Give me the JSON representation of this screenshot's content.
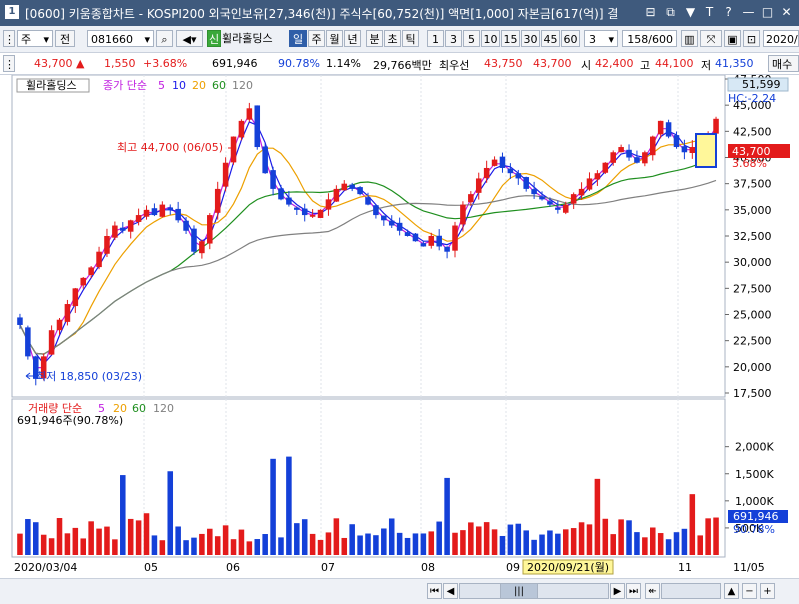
{
  "window": {
    "app_number": "1",
    "title": "[0600] 키움종합차트 - KOSPI200 외국인보유[27,346(천)] 주식수[60,752(천)] 액면[1,000] 자본금[617(억)] 결",
    "buttons": [
      "⊟",
      "⧉",
      "▼",
      "T",
      "?",
      "—",
      "□",
      "✕"
    ]
  },
  "toolbar": {
    "period_unit": "주",
    "before_label": "전",
    "stock_code": "081660",
    "badge": "신",
    "stock_name": "휠라홀딩스",
    "period_tabs": [
      "일",
      "주",
      "월",
      "년",
      "분",
      "초",
      "틱"
    ],
    "active_period": "일",
    "intervals": [
      "1",
      "3",
      "5",
      "10",
      "15",
      "30",
      "45",
      "60"
    ],
    "interval_value": "3",
    "count": "158/600",
    "date": "2020/"
  },
  "quote": {
    "price": "43,700",
    "change": "1,550",
    "change_pct": "+3.68%",
    "volume": "691,946",
    "volume_pct": "90.78%",
    "turnover_pct": "1.14%",
    "amount": "29,766백만",
    "best_ask_label": "최우선",
    "best_ask": "43,750",
    "best_bid": "43,700",
    "open_label": "시",
    "open": "42,400",
    "high_label": "고",
    "high": "44,100",
    "low_label": "저",
    "low": "41,350",
    "trade_btn": "매수"
  },
  "price_panel": {
    "legend_name": "휠라홀딩스",
    "legend_text": "종가 단순",
    "ma_periods": [
      "5",
      "10",
      "20",
      "60",
      "120"
    ],
    "ma_colors": [
      "#c11de0",
      "#1a1ae8",
      "#eda000",
      "#1f8f1f",
      "#808080"
    ],
    "up_color": "#e31b1b",
    "down_color": "#1440d8",
    "annot_high": "최고 44,700 (06/05)",
    "annot_low": "최저 18,850 (03/23)",
    "current_tag": "51,599",
    "hc_text": "HC:-2.24",
    "price_tag": "43,700",
    "pct_tag": "3.68%",
    "axis_labels": [
      "47,500",
      "45,000",
      "42,500",
      "40,000",
      "37,500",
      "35,000",
      "32,500",
      "30,000",
      "27,500",
      "25,000",
      "22,500",
      "20,000",
      "17,500"
    ]
  },
  "volume_panel": {
    "legend_text": "거래량 단순",
    "ma_periods": [
      "5",
      "20",
      "60",
      "120"
    ],
    "info": "691,946주(90.78%)",
    "axis_labels": [
      "2,000K",
      "1,500K",
      "1,000K",
      "500K"
    ],
    "tag_value": "691,946",
    "tag_pct": "90.78%"
  },
  "date_axis": {
    "labels": [
      "2020/03/04",
      "05",
      "06",
      "07",
      "08",
      "09",
      "11",
      "11/05"
    ],
    "cursor_date": "2020/09/21(월)"
  },
  "chart_data": {
    "type": "candlestick",
    "symbol": "081660",
    "name": "휠라홀딩스",
    "period": "daily",
    "x_range": [
      "2020-03-04",
      "2020-11-05"
    ],
    "price_unit": "KRW",
    "ylim": [
      17500,
      47500
    ],
    "price_path": [
      24000,
      21000,
      18850,
      21000,
      23500,
      24500,
      26000,
      27500,
      28500,
      29500,
      31000,
      32500,
      33500,
      33000,
      34000,
      34500,
      35000,
      34500,
      35500,
      35000,
      34000,
      33000,
      31000,
      32000,
      34500,
      37000,
      39500,
      42000,
      43500,
      44700,
      41000,
      38500,
      37000,
      36000,
      35500,
      35000,
      34500,
      34500,
      35000,
      36000,
      37000,
      37500,
      37000,
      36500,
      35500,
      34500,
      34000,
      33500,
      33000,
      32500,
      32000,
      31500,
      32500,
      31500,
      31000,
      33500,
      35500,
      36500,
      38000,
      39000,
      39800,
      39000,
      38500,
      38000,
      37000,
      36500,
      36000,
      35500,
      35000,
      35500,
      36500,
      37000,
      38000,
      38500,
      39500,
      40500,
      41000,
      40000,
      39500,
      40500,
      42000,
      43500,
      42000,
      41000,
      40500,
      41000,
      41500,
      42000,
      43700
    ],
    "high": {
      "value": 44700,
      "date": "06/05"
    },
    "low": {
      "value": 18850,
      "date": "03/23"
    },
    "last": {
      "close": 43700,
      "open": 42400,
      "high": 44100,
      "low": 41350,
      "change": 1550,
      "change_pct": 3.68
    },
    "volume": {
      "last": 691946,
      "last_pct": 90.78,
      "ylim": [
        0,
        2400000
      ]
    }
  }
}
